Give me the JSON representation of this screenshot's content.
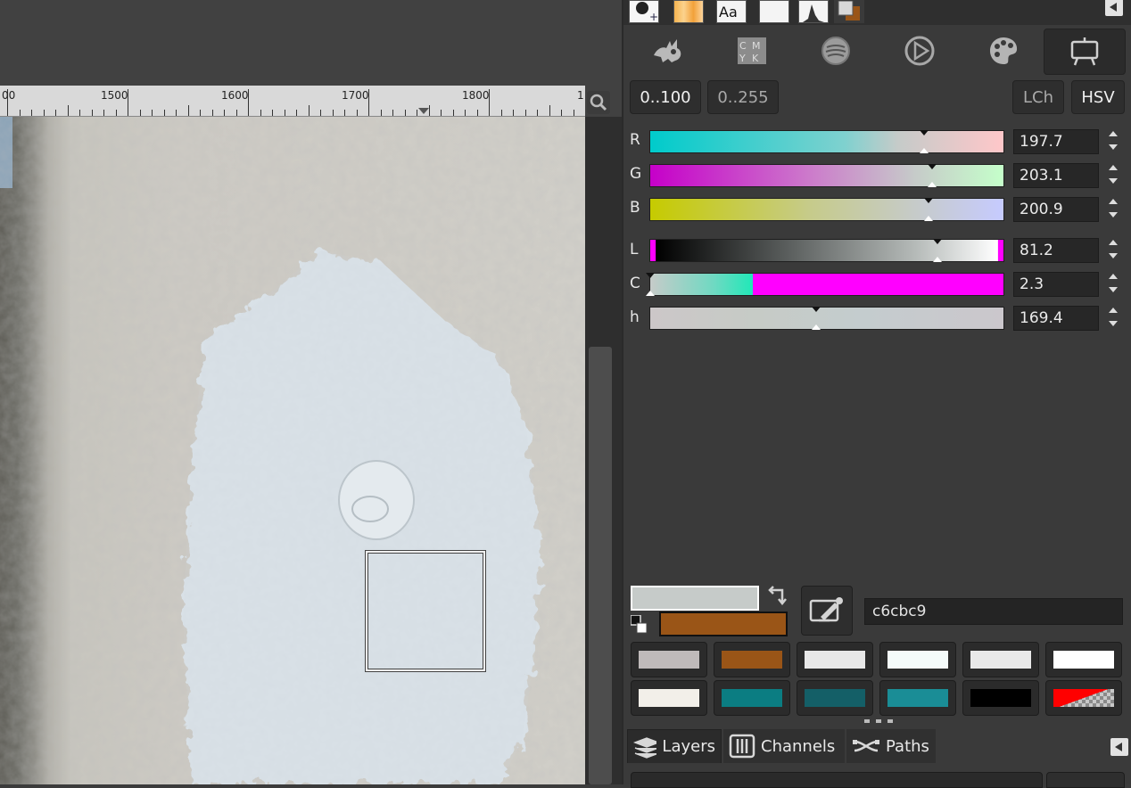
{
  "ruler": {
    "labels": [
      "00",
      "1500",
      "1600",
      "1700",
      "1800",
      "1"
    ]
  },
  "color_selector": {
    "range_buttons": [
      "0..100",
      "0..255"
    ],
    "model_buttons": [
      "LCh",
      "HSV"
    ],
    "channels": [
      {
        "label": "R",
        "value": "197.7",
        "level": 0.775
      },
      {
        "label": "G",
        "value": "203.1",
        "level": 0.797
      },
      {
        "label": "B",
        "value": "200.9",
        "level": 0.788
      },
      {
        "label": "L",
        "value": "81.2",
        "level": 0.812
      },
      {
        "label": "C",
        "value": "2.3",
        "level": 0.0
      },
      {
        "label": "h",
        "value": "169.4",
        "level": 0.47
      }
    ],
    "hex": "c6cbc9",
    "fg_color": "#c6cbc9",
    "bg_color": "#9a5517"
  },
  "history": [
    {
      "color": "#bfbaba"
    },
    {
      "color": "#9a5517"
    },
    {
      "color": "#e8e8e8"
    },
    {
      "color": "#f4fbfa"
    },
    {
      "color": "#e9e9e9"
    },
    {
      "color": "#ffffff"
    },
    {
      "color": "#f2efe9"
    },
    {
      "color": "#0b7d82"
    },
    {
      "color": "#145f67"
    },
    {
      "color": "#1a8d96"
    },
    {
      "color": "#000000"
    },
    {
      "color": "transparent"
    }
  ],
  "bottom_tabs": {
    "layers": "Layers",
    "channels": "Channels",
    "paths": "Paths"
  }
}
